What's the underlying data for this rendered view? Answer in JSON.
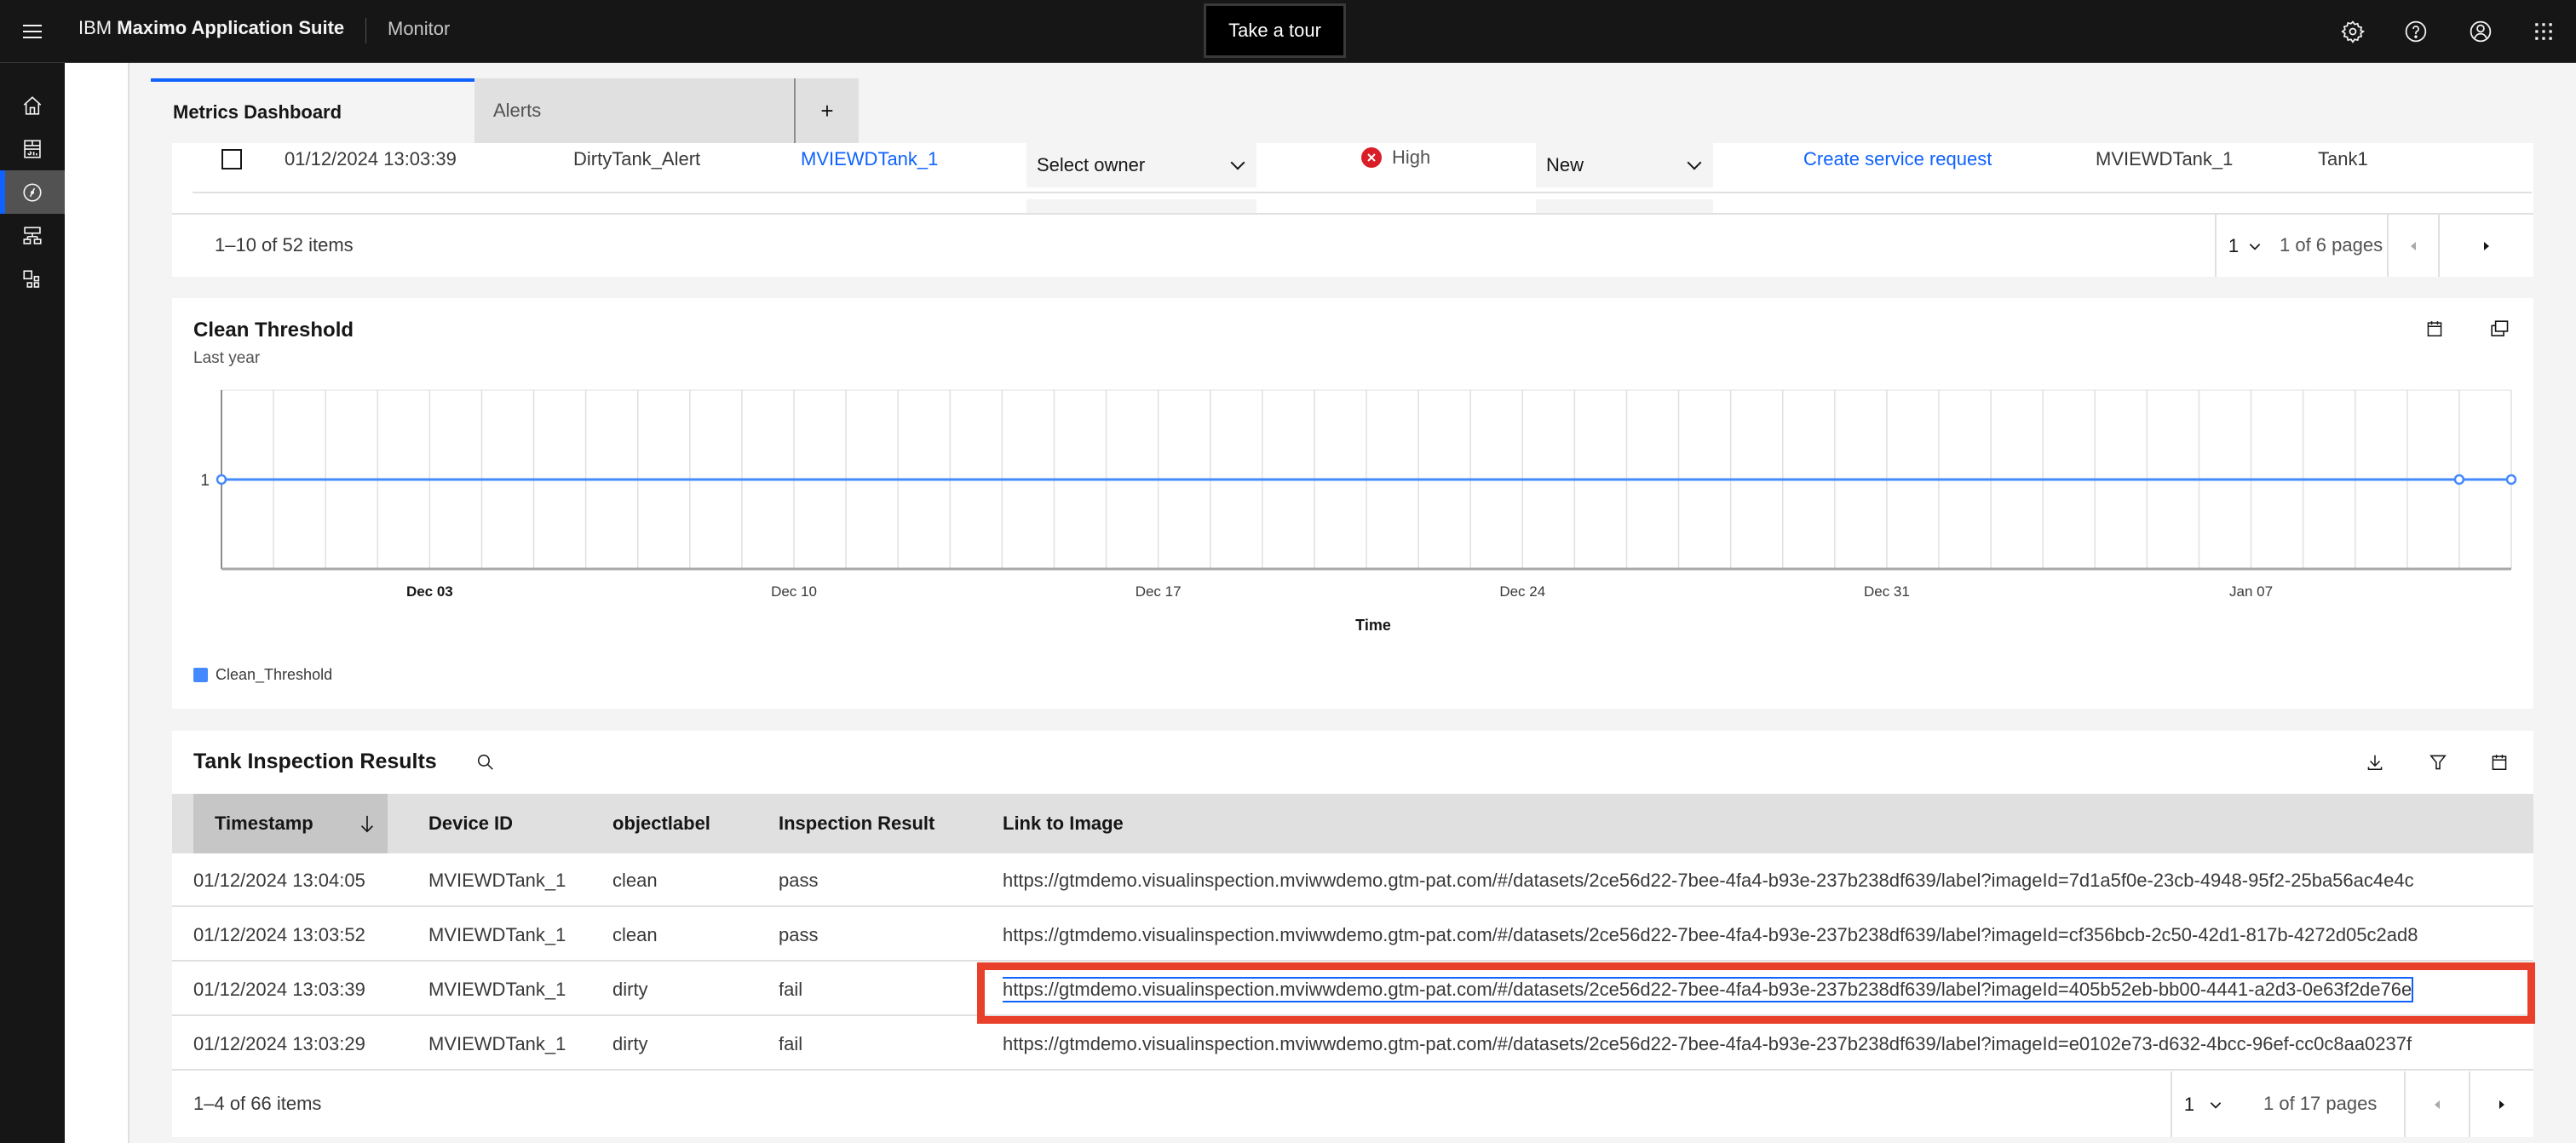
{
  "header": {
    "brand_prefix": "IBM",
    "brand_name": "Maximo Application Suite",
    "product": "Monitor",
    "tour_button": "Take a tour",
    "icons": [
      "settings-icon",
      "help-icon",
      "user-icon",
      "app-switcher-icon"
    ]
  },
  "sidebar": {
    "items": [
      {
        "name": "home",
        "icon": "home-icon",
        "active": false
      },
      {
        "name": "dashboards",
        "icon": "dashboard-icon",
        "active": false
      },
      {
        "name": "monitor",
        "icon": "compass-icon",
        "active": true
      },
      {
        "name": "hierarchy",
        "icon": "hierarchy-icon",
        "active": false
      },
      {
        "name": "devices",
        "icon": "devices-icon",
        "active": false
      }
    ]
  },
  "tabs": [
    {
      "label": "Metrics Dashboard",
      "active": true
    },
    {
      "label": "Alerts",
      "active": false
    },
    {
      "label": "+",
      "active": false
    }
  ],
  "alerts_table": {
    "row": {
      "checked": false,
      "timestamp": "01/12/2024 13:03:39",
      "alert": "DirtyTank_Alert",
      "device": "MVIEWDTank_1",
      "owner_placeholder": "Select owner",
      "severity": "High",
      "status": "New",
      "action": "Create service request",
      "device_id": "MVIEWDTank_1",
      "asset": "Tank1"
    },
    "pagination": {
      "range": "1–10 of 52 items",
      "page": "1",
      "pages": "1 of 6 pages"
    }
  },
  "chart": {
    "title": "Clean Threshold",
    "subtitle": "Last year",
    "icons": [
      "calendar-icon",
      "expand-icon"
    ]
  },
  "chart_data": {
    "type": "line",
    "title": "Clean Threshold",
    "subtitle": "Last year",
    "xlabel": "Time",
    "ylabel": "",
    "x_tick_labels": [
      "Dec 03",
      "Dec 10",
      "Dec 17",
      "Dec 24",
      "Dec 31",
      "Jan 07"
    ],
    "y_tick_labels": [
      "1"
    ],
    "xlim": [
      "Nov 29",
      "Jan 12"
    ],
    "grid": "vertical-daily",
    "legend": {
      "placement": "bottom-left",
      "entries": [
        "Clean_Threshold"
      ]
    },
    "series": [
      {
        "name": "Clean_Threshold",
        "color": "#4589ff",
        "x": [
          "Nov 29",
          "Jan 11",
          "Jan 12"
        ],
        "values": [
          1,
          1,
          1
        ]
      }
    ]
  },
  "inspection_table": {
    "title": "Tank Inspection Results",
    "toolbar_icons": [
      "search-icon",
      "download-icon",
      "filter-icon",
      "calendar-icon"
    ],
    "columns": [
      "Timestamp",
      "Device ID",
      "objectlabel",
      "Inspection Result",
      "Link to Image"
    ],
    "sort": {
      "column": "Timestamp",
      "direction": "descending"
    },
    "rows": [
      {
        "timestamp": "01/12/2024 13:04:05",
        "device": "MVIEWDTank_1",
        "label": "clean",
        "result": "pass",
        "link": "https://gtmdemo.visualinspection.mviwwdemo.gtm-pat.com/#/datasets/2ce56d22-7bee-4fa4-b93e-237b238df639/label?imageId=7d1a5f0e-23cb-4948-95f2-25ba56ac4e4c"
      },
      {
        "timestamp": "01/12/2024 13:03:52",
        "device": "MVIEWDTank_1",
        "label": "clean",
        "result": "pass",
        "link": "https://gtmdemo.visualinspection.mviwwdemo.gtm-pat.com/#/datasets/2ce56d22-7bee-4fa4-b93e-237b238df639/label?imageId=cf356bcb-2c50-42d1-817b-4272d05c2ad8"
      },
      {
        "timestamp": "01/12/2024 13:03:39",
        "device": "MVIEWDTank_1",
        "label": "dirty",
        "result": "fail",
        "link": "https://gtmdemo.visualinspection.mviwwdemo.gtm-pat.com/#/datasets/2ce56d22-7bee-4fa4-b93e-237b238df639/label?imageId=405b52eb-bb00-4441-a2d3-0e63f2de76e"
      },
      {
        "timestamp": "01/12/2024 13:03:29",
        "device": "MVIEWDTank_1",
        "label": "dirty",
        "result": "fail",
        "link": "https://gtmdemo.visualinspection.mviwwdemo.gtm-pat.com/#/datasets/2ce56d22-7bee-4fa4-b93e-237b238df639/label?imageId=e0102e73-d632-4bcc-96ef-cc0c8aa0237f"
      }
    ],
    "pagination": {
      "range": "1–4 of 66 items",
      "page": "1",
      "pages": "1 of 17 pages"
    }
  },
  "colors": {
    "accent": "#0f62fe",
    "header_bg": "#161616",
    "severity_high": "#da1e28",
    "highlight": "#e8402a",
    "series": "#4589ff"
  }
}
